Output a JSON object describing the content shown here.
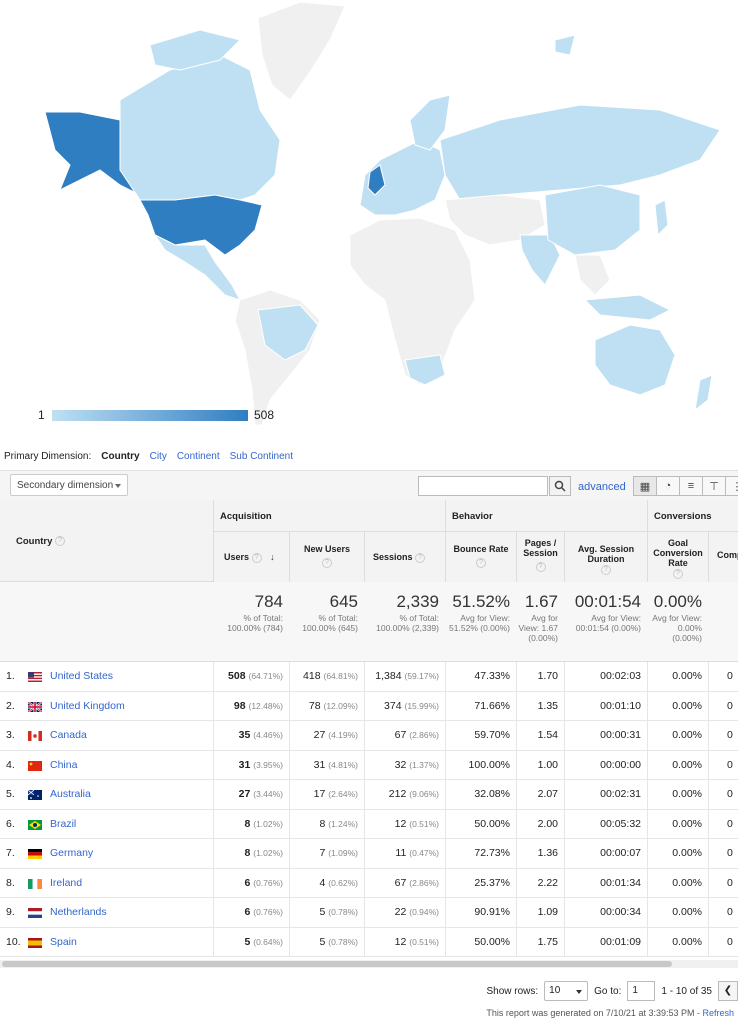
{
  "map": {
    "legend_min": "1",
    "legend_max": "508",
    "colors": {
      "low": "#bfe0f2",
      "high": "#2f7ec1",
      "none": "#f0f0f0"
    }
  },
  "dimension": {
    "label": "Primary Dimension:",
    "active": "Country",
    "options": [
      "City",
      "Continent",
      "Sub Continent"
    ]
  },
  "toolbar": {
    "secondary_dimension": "Secondary dimension",
    "advanced": "advanced"
  },
  "headers": {
    "country": "Country",
    "acquisition": "Acquisition",
    "behavior": "Behavior",
    "conversions": "Conversions",
    "users": "Users",
    "new_users": "New Users",
    "sessions": "Sessions",
    "bounce_rate": "Bounce Rate",
    "pages_session": "Pages / Session",
    "avg_duration": "Avg. Session Duration",
    "goal_rate": "Goal Conversion Rate",
    "goal_comp": "Comp"
  },
  "totals": {
    "users": "784",
    "users_sub": "% of Total: 100.00% (784)",
    "new_users": "645",
    "new_users_sub": "% of Total: 100.00% (645)",
    "sessions": "2,339",
    "sessions_sub": "% of Total: 100.00% (2,339)",
    "bounce": "51.52%",
    "bounce_sub": "Avg for View: 51.52% (0.00%)",
    "pages": "1.67",
    "pages_sub": "Avg for View: 1.67 (0.00%)",
    "duration": "00:01:54",
    "duration_sub": "Avg for View: 00:01:54 (0.00%)",
    "goal": "0.00%",
    "goal_sub": "Avg for View: 0.00% (0.00%)"
  },
  "rows": [
    {
      "idx": "1.",
      "country": "United States",
      "flag": "us",
      "users": "508",
      "users_pct": "(64.71%)",
      "new": "418",
      "new_pct": "(64.81%)",
      "sess": "1,384",
      "sess_pct": "(59.17%)",
      "bounce": "47.33%",
      "pages": "1.70",
      "dur": "00:02:03",
      "goal": "0.00%",
      "comp": "0"
    },
    {
      "idx": "2.",
      "country": "United Kingdom",
      "flag": "gb",
      "users": "98",
      "users_pct": "(12.48%)",
      "new": "78",
      "new_pct": "(12.09%)",
      "sess": "374",
      "sess_pct": "(15.99%)",
      "bounce": "71.66%",
      "pages": "1.35",
      "dur": "00:01:10",
      "goal": "0.00%",
      "comp": "0"
    },
    {
      "idx": "3.",
      "country": "Canada",
      "flag": "ca",
      "users": "35",
      "users_pct": "(4.46%)",
      "new": "27",
      "new_pct": "(4.19%)",
      "sess": "67",
      "sess_pct": "(2.86%)",
      "bounce": "59.70%",
      "pages": "1.54",
      "dur": "00:00:31",
      "goal": "0.00%",
      "comp": "0"
    },
    {
      "idx": "4.",
      "country": "China",
      "flag": "cn",
      "users": "31",
      "users_pct": "(3.95%)",
      "new": "31",
      "new_pct": "(4.81%)",
      "sess": "32",
      "sess_pct": "(1.37%)",
      "bounce": "100.00%",
      "pages": "1.00",
      "dur": "00:00:00",
      "goal": "0.00%",
      "comp": "0"
    },
    {
      "idx": "5.",
      "country": "Australia",
      "flag": "au",
      "users": "27",
      "users_pct": "(3.44%)",
      "new": "17",
      "new_pct": "(2.64%)",
      "sess": "212",
      "sess_pct": "(9.06%)",
      "bounce": "32.08%",
      "pages": "2.07",
      "dur": "00:02:31",
      "goal": "0.00%",
      "comp": "0"
    },
    {
      "idx": "6.",
      "country": "Brazil",
      "flag": "br",
      "users": "8",
      "users_pct": "(1.02%)",
      "new": "8",
      "new_pct": "(1.24%)",
      "sess": "12",
      "sess_pct": "(0.51%)",
      "bounce": "50.00%",
      "pages": "2.00",
      "dur": "00:05:32",
      "goal": "0.00%",
      "comp": "0"
    },
    {
      "idx": "7.",
      "country": "Germany",
      "flag": "de",
      "users": "8",
      "users_pct": "(1.02%)",
      "new": "7",
      "new_pct": "(1.09%)",
      "sess": "11",
      "sess_pct": "(0.47%)",
      "bounce": "72.73%",
      "pages": "1.36",
      "dur": "00:00:07",
      "goal": "0.00%",
      "comp": "0"
    },
    {
      "idx": "8.",
      "country": "Ireland",
      "flag": "ie",
      "users": "6",
      "users_pct": "(0.76%)",
      "new": "4",
      "new_pct": "(0.62%)",
      "sess": "67",
      "sess_pct": "(2.86%)",
      "bounce": "25.37%",
      "pages": "2.22",
      "dur": "00:01:34",
      "goal": "0.00%",
      "comp": "0"
    },
    {
      "idx": "9.",
      "country": "Netherlands",
      "flag": "nl",
      "users": "6",
      "users_pct": "(0.76%)",
      "new": "5",
      "new_pct": "(0.78%)",
      "sess": "22",
      "sess_pct": "(0.94%)",
      "bounce": "90.91%",
      "pages": "1.09",
      "dur": "00:00:34",
      "goal": "0.00%",
      "comp": "0"
    },
    {
      "idx": "10.",
      "country": "Spain",
      "flag": "es",
      "users": "5",
      "users_pct": "(0.64%)",
      "new": "5",
      "new_pct": "(0.78%)",
      "sess": "12",
      "sess_pct": "(0.51%)",
      "bounce": "50.00%",
      "pages": "1.75",
      "dur": "00:01:09",
      "goal": "0.00%",
      "comp": "0"
    }
  ],
  "pager": {
    "show_rows_label": "Show rows:",
    "show_rows_value": "10",
    "goto_label": "Go to:",
    "goto_value": "1",
    "range": "1 - 10 of 35"
  },
  "footer": {
    "generated": "This report was generated on 7/10/21 at 3:39:53 PM - ",
    "refresh": "Refresh"
  }
}
